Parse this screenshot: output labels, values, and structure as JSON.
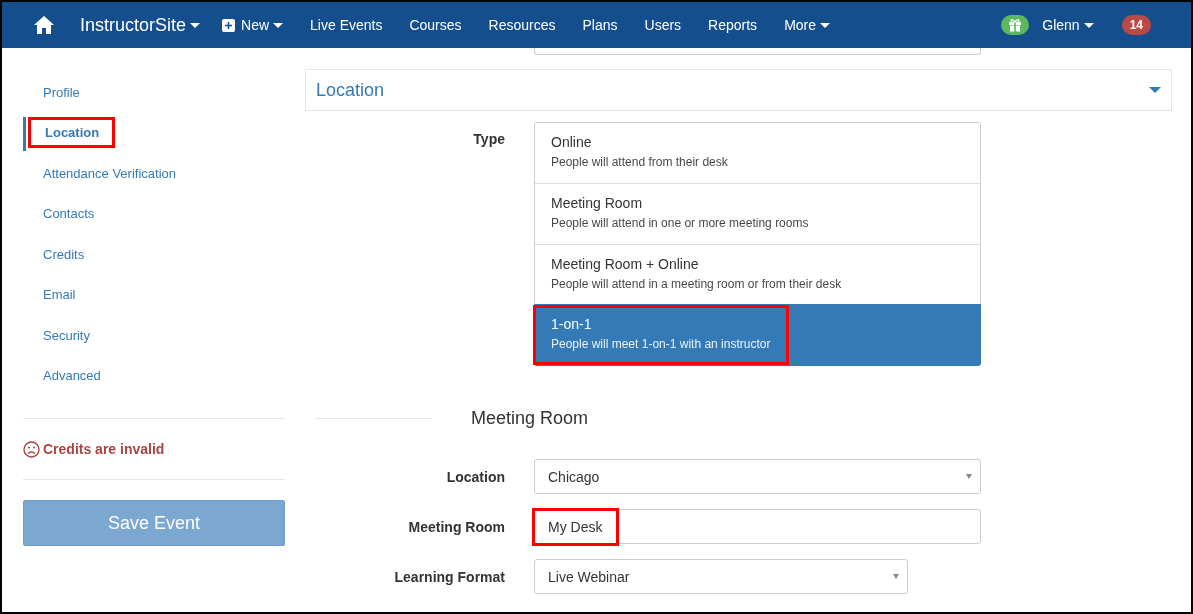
{
  "nav": {
    "brand": "InstructorSite",
    "new_label": "New",
    "links": [
      "Live Events",
      "Courses",
      "Resources",
      "Plans",
      "Users",
      "Reports"
    ],
    "more": "More",
    "user": "Glenn",
    "badge": "14"
  },
  "sidebar": {
    "items": [
      {
        "label": "Profile",
        "selected": false,
        "highlighted": false
      },
      {
        "label": "Location",
        "selected": true,
        "highlighted": true
      },
      {
        "label": "Attendance Verification",
        "selected": false,
        "highlighted": false
      },
      {
        "label": "Contacts",
        "selected": false,
        "highlighted": false
      },
      {
        "label": "Credits",
        "selected": false,
        "highlighted": false
      },
      {
        "label": "Email",
        "selected": false,
        "highlighted": false
      },
      {
        "label": "Security",
        "selected": false,
        "highlighted": false
      },
      {
        "label": "Advanced",
        "selected": false,
        "highlighted": false
      }
    ],
    "warning": "Credits are invalid",
    "save_button": "Save Event"
  },
  "panel": {
    "title": "Location",
    "type_label": "Type",
    "types": [
      {
        "title": "Online",
        "description": "People will attend from their desk",
        "selected": false,
        "highlighted": false
      },
      {
        "title": "Meeting Room",
        "description": "People will attend in one or more meeting rooms",
        "selected": false,
        "highlighted": false
      },
      {
        "title": "Meeting Room + Online",
        "description": "People will attend in a meeting room or from their desk",
        "selected": false,
        "highlighted": false
      },
      {
        "title": "1-on-1",
        "description": "People will meet 1-on-1 with an instructor",
        "selected": true,
        "highlighted": true
      }
    ],
    "section_title": "Meeting Room",
    "fields": [
      {
        "kind": "select",
        "label": "Location",
        "value": "Chicago",
        "highlighted": false,
        "narrow": false
      },
      {
        "kind": "text",
        "label": "Meeting Room",
        "value": "My Desk",
        "highlighted": true,
        "narrow": false
      },
      {
        "kind": "select",
        "label": "Learning Format",
        "value": "Live Webinar",
        "highlighted": false,
        "narrow": true
      }
    ]
  }
}
